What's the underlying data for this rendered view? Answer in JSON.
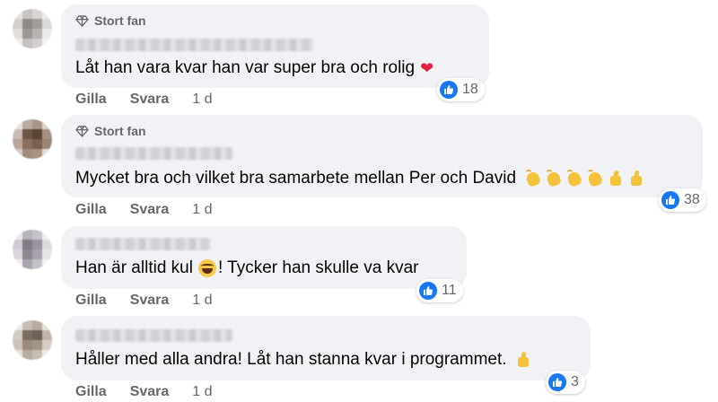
{
  "colors": {
    "bubble": "#f0f2f5",
    "like_blue": "#1877f2",
    "secondary_text": "#65676b",
    "heart": "#e41e3f"
  },
  "comments": [
    {
      "badge": "Stort fan",
      "text": "Låt han vara kvar han var super bra och rolig",
      "emoji": [
        "red-heart"
      ],
      "reaction_count": "18",
      "like_label": "Gilla",
      "reply_label": "Svara",
      "time": "1 d"
    },
    {
      "badge": "Stort fan",
      "text": "Mycket bra och vilket bra samarbete mellan Per och David",
      "emoji": [
        "clapping-hands",
        "clapping-hands",
        "clapping-hands",
        "clapping-hands",
        "thumbs-up",
        "thumbs-up"
      ],
      "reaction_count": "38",
      "like_label": "Gilla",
      "reply_label": "Svara",
      "time": "1 d"
    },
    {
      "badge": "",
      "text_before": "Han är alltid kul",
      "text_after": "! Tycker han skulle va kvar",
      "emoji": [
        "tears-of-joy"
      ],
      "reaction_count": "11",
      "like_label": "Gilla",
      "reply_label": "Svara",
      "time": "1 d"
    },
    {
      "badge": "",
      "text": "Håller med alla andra! Låt han stanna kvar i programmet.",
      "emoji": [
        "thumbs-up"
      ],
      "reaction_count": "3",
      "like_label": "Gilla",
      "reply_label": "Svara",
      "time": "1 d"
    }
  ]
}
